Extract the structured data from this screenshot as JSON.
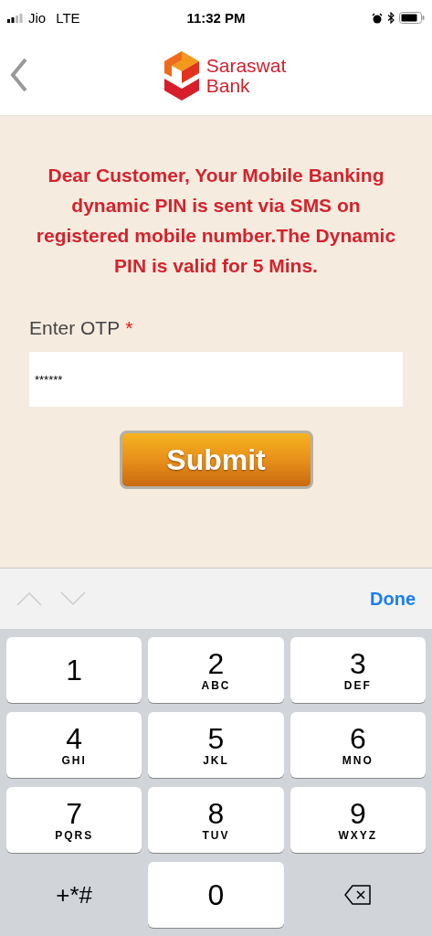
{
  "status_bar": {
    "carrier": "Jio",
    "network": "LTE",
    "time": "11:32 PM"
  },
  "header": {
    "logo_line_1": "Saraswat",
    "logo_line_2": "Bank"
  },
  "message": "Dear Customer, Your Mobile Banking dynamic PIN is sent via SMS on registered mobile number.The Dynamic PIN is valid for 5 Mins.",
  "otp_field": {
    "label": "Enter OTP",
    "required_mark": "*",
    "value": "******"
  },
  "submit_button": "Submit",
  "keyboard_toolbar": {
    "arrows": [
      {
        "kind": "up",
        "disabled": true
      },
      {
        "kind": "down",
        "disabled": true
      }
    ],
    "done": "Done"
  },
  "keys": [
    {
      "kind": "digit",
      "digit": "1"
    },
    {
      "kind": "digit",
      "digit": "2",
      "letters": "ABC"
    },
    {
      "kind": "digit",
      "digit": "3",
      "letters": "DEF"
    },
    {
      "kind": "digit",
      "digit": "4",
      "letters": "GHI"
    },
    {
      "kind": "digit",
      "digit": "5",
      "letters": "JKL"
    },
    {
      "kind": "digit",
      "digit": "6",
      "letters": "MNO"
    },
    {
      "kind": "digit",
      "digit": "7",
      "letters": "PQRS"
    },
    {
      "kind": "digit",
      "digit": "8",
      "letters": "TUV"
    },
    {
      "kind": "digit",
      "digit": "9",
      "letters": "WXYZ"
    },
    {
      "kind": "symbols",
      "label": "+*#"
    },
    {
      "kind": "digit",
      "digit": "0"
    },
    {
      "kind": "delete"
    }
  ]
}
